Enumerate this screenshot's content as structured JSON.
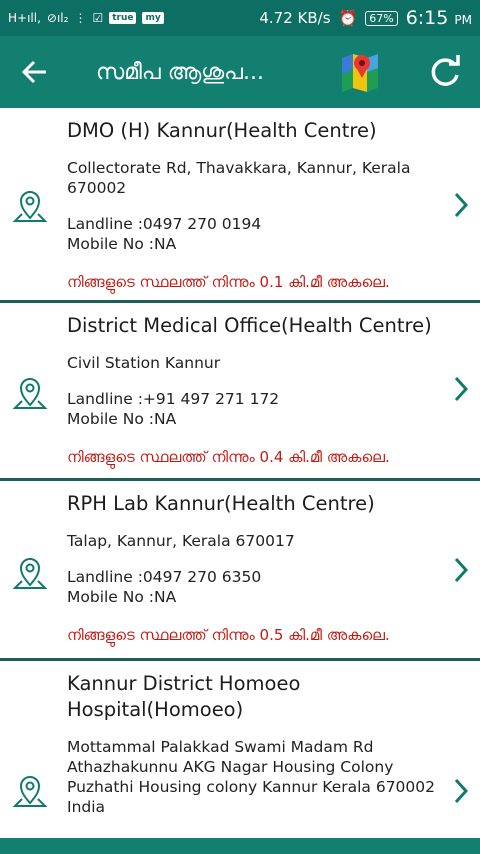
{
  "status": {
    "left_icons": [
      "H+ signal",
      "no-signal",
      "vibration",
      "data-check",
      "true",
      "my"
    ],
    "speed": "4.72 KB/s",
    "battery": "67%",
    "time": "6:15",
    "ampm": "PM",
    "chip_true": "true",
    "chip_my": "my"
  },
  "appbar": {
    "title": "സമീപ ആശുപ...",
    "back_icon": "arrow-left",
    "map_icon": "google-maps",
    "refresh_icon": "refresh"
  },
  "items": [
    {
      "name": "DMO (H) Kannur(Health Centre)",
      "address": "Collectorate Rd, Thavakkara, Kannur, Kerala 670002",
      "landline": "Landline :0497 270 0194",
      "mobile": "Mobile No :NA",
      "distance": "നിങ്ങളുടെ സ്ഥലത്ത് നിന്നും 0.1 കി.മീ അകലെ."
    },
    {
      "name": "District Medical Office(Health Centre)",
      "address": "Civil Station Kannur",
      "landline": "Landline :+91 497 271 172",
      "mobile": "Mobile No :NA",
      "distance": "നിങ്ങളുടെ സ്ഥലത്ത് നിന്നും 0.4 കി.മീ അകലെ."
    },
    {
      "name": "RPH Lab Kannur(Health Centre)",
      "address": "Talap, Kannur, Kerala 670017",
      "landline": "Landline :0497 270 6350",
      "mobile": "Mobile No :NA",
      "distance": "നിങ്ങളുടെ സ്ഥലത്ത് നിന്നും 0.5 കി.മീ അകലെ."
    },
    {
      "name": "Kannur District Homoeo Hospital(Homoeo)",
      "address": "Mottammal Palakkad Swami Madam Rd Athazhakunnu AKG Nagar Housing Colony Puzhathi Housing colony Kannur Kerala 670002 India",
      "landline": "",
      "mobile": "",
      "distance": ""
    }
  ],
  "colors": {
    "statusbar": "#0d6f63",
    "appbar": "#137f71",
    "icon_teal": "#0f7a6d",
    "distance_red": "#c41a12"
  }
}
